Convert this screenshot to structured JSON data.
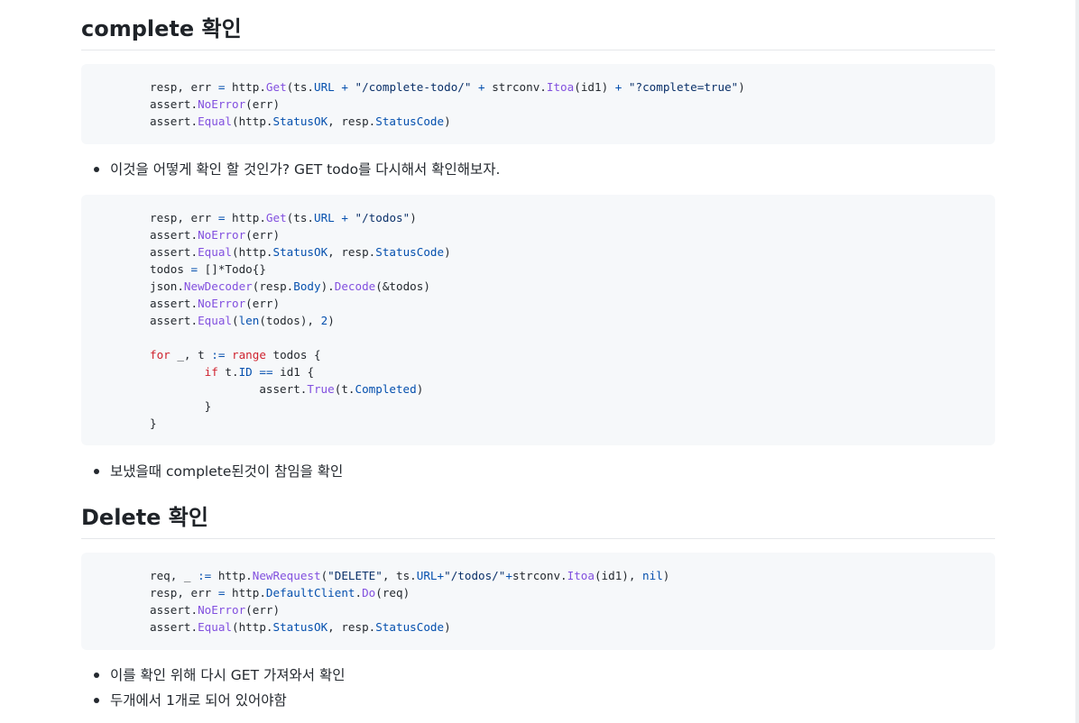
{
  "sections": [
    {
      "title": "complete 확인",
      "code": [
        "resp, err = http.Get(ts.URL + \"/complete-todo/\" + strconv.Itoa(id1) + \"?complete=true\")",
        "assert.NoError(err)",
        "assert.Equal(http.StatusOK, resp.StatusCode)"
      ],
      "bullets": [
        "이것을 어떻게 확인 할 것인가? GET todo를 다시해서 확인해보자."
      ]
    },
    {
      "code": [
        "resp, err = http.Get(ts.URL + \"/todos\")",
        "assert.NoError(err)",
        "assert.Equal(http.StatusOK, resp.StatusCode)",
        "todos = []*Todo{}",
        "json.NewDecoder(resp.Body).Decode(&todos)",
        "assert.NoError(err)",
        "assert.Equal(len(todos), 2)",
        "",
        "for _, t := range todos {",
        "        if t.ID == id1 {",
        "                assert.True(t.Completed)",
        "        }",
        "}"
      ],
      "bullets": [
        "보냈을때 complete된것이 참임을 확인"
      ]
    },
    {
      "title": "Delete 확인",
      "code": [
        "req, _ := http.NewRequest(\"DELETE\", ts.URL+\"/todos/\"+strconv.Itoa(id1), nil)",
        "resp, err = http.DefaultClient.Do(req)",
        "assert.NoError(err)",
        "assert.Equal(http.StatusOK, resp.StatusCode)"
      ],
      "bullets": [
        "이를 확인 위해 다시 GET 가져와서 확인",
        "두개에서 1개로 되어 있어야함"
      ]
    }
  ]
}
